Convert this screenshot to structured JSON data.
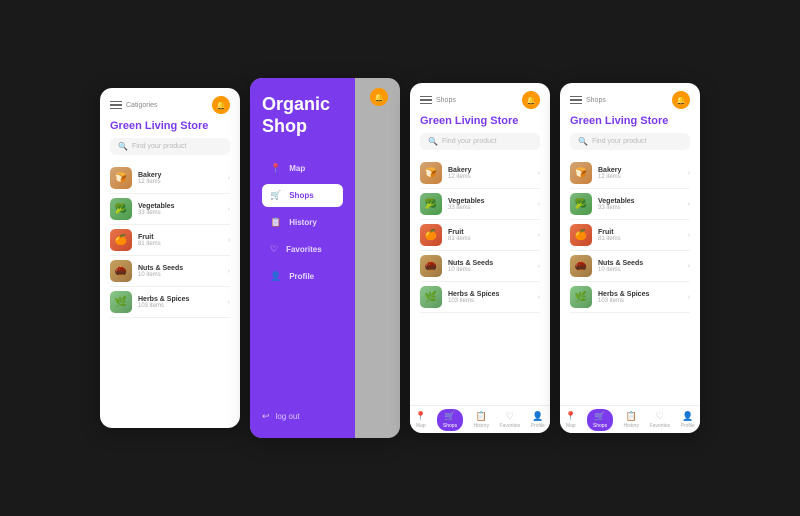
{
  "screens": [
    {
      "id": "screen1",
      "header": {
        "title": "Catigories",
        "store_name": "Green Living Store"
      },
      "search": {
        "placeholder": "Find your product"
      },
      "categories": [
        {
          "name": "Bakery",
          "count": "12 items",
          "emoji": "🍞"
        },
        {
          "name": "Vegetables",
          "count": "33 items",
          "emoji": "🥦"
        },
        {
          "name": "Fruit",
          "count": "81 items",
          "emoji": "🍊"
        },
        {
          "name": "Nuts & Seeds",
          "count": "10 items",
          "emoji": "🌰"
        },
        {
          "name": "Herbs & Spices",
          "count": "103 items",
          "emoji": "🌿"
        }
      ],
      "hasBottomNav": false
    },
    {
      "id": "screen2",
      "drawer": {
        "title": "Organic Shop",
        "items": [
          {
            "label": "Map",
            "icon": "📍",
            "active": false
          },
          {
            "label": "Shops",
            "icon": "🛒",
            "active": true
          },
          {
            "label": "History",
            "icon": "📋",
            "active": false
          },
          {
            "label": "Favorites",
            "icon": "♡",
            "active": false
          },
          {
            "label": "Profile",
            "icon": "👤",
            "active": false
          }
        ],
        "logout": "log out"
      }
    },
    {
      "id": "screen3",
      "header": {
        "title": "Shops",
        "store_name": "Green Living Store"
      },
      "search": {
        "placeholder": "Find your product"
      },
      "categories": [
        {
          "name": "Bakery",
          "count": "12 items",
          "emoji": "🍞"
        },
        {
          "name": "Vegetables",
          "count": "33 items",
          "emoji": "🥦"
        },
        {
          "name": "Fruit",
          "count": "81 items",
          "emoji": "🍊"
        },
        {
          "name": "Nuts & Seeds",
          "count": "10 items",
          "emoji": "🌰"
        },
        {
          "name": "Herbs & Spices",
          "count": "103 items",
          "emoji": "🌿"
        }
      ],
      "bottomNav": [
        {
          "label": "Map",
          "icon": "📍",
          "active": false
        },
        {
          "label": "Shops",
          "icon": "🛒",
          "active": true
        },
        {
          "label": "History",
          "icon": "📋",
          "active": false
        },
        {
          "label": "Favorites",
          "icon": "♡",
          "active": false
        },
        {
          "label": "Profile",
          "icon": "👤",
          "active": false
        }
      ]
    },
    {
      "id": "screen4",
      "header": {
        "title": "Shops",
        "store_name": "Green Living Store"
      },
      "search": {
        "placeholder": "Find your product"
      },
      "categories": [
        {
          "name": "Bakery",
          "count": "12 items",
          "emoji": "🍞"
        },
        {
          "name": "Vegetables",
          "count": "33 items",
          "emoji": "🥦"
        },
        {
          "name": "Fruit",
          "count": "81 items",
          "emoji": "🍊"
        },
        {
          "name": "Nuts & Seeds",
          "count": "10 items",
          "emoji": "🌰"
        },
        {
          "name": "Herbs & Spices",
          "count": "103 items",
          "emoji": "🌿"
        }
      ],
      "bottomNav": [
        {
          "label": "Map",
          "icon": "📍",
          "active": false
        },
        {
          "label": "Shops",
          "icon": "🛒",
          "active": true
        },
        {
          "label": "History",
          "icon": "📋",
          "active": false
        },
        {
          "label": "Favorites",
          "icon": "♡",
          "active": false
        },
        {
          "label": "Profile",
          "icon": "👤",
          "active": false
        }
      ]
    }
  ]
}
